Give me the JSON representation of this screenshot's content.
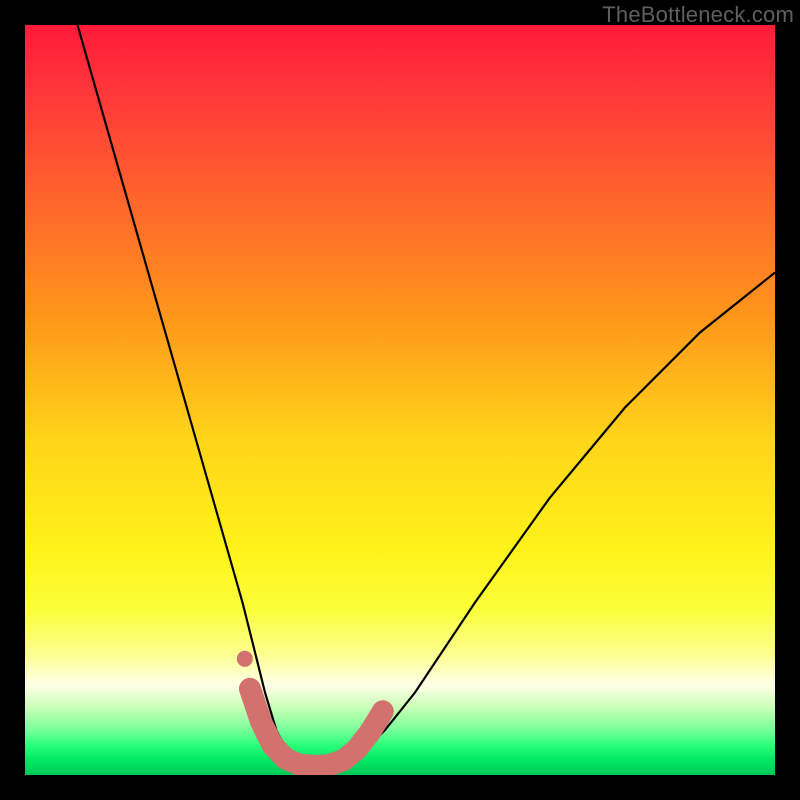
{
  "watermark": "TheBottleneck.com",
  "colors": {
    "curve_stroke": "#000000",
    "marker_fill": "#d2716e",
    "background_black": "#000000"
  },
  "chart_data": {
    "type": "line",
    "title": "",
    "xlabel": "",
    "ylabel": "",
    "xlim": [
      0,
      100
    ],
    "ylim": [
      0,
      100
    ],
    "grid": false,
    "legend": false,
    "series": [
      {
        "name": "bottleneck-curve",
        "x": [
          7,
          9,
          11,
          13,
          15,
          17,
          19,
          21,
          23,
          25,
          27,
          29,
          30.5,
          32,
          33.5,
          35,
          36.5,
          38,
          40,
          42,
          45,
          48,
          52,
          56,
          60,
          65,
          70,
          75,
          80,
          85,
          90,
          95,
          100
        ],
        "y": [
          100,
          93,
          86,
          79,
          72,
          65,
          58,
          51,
          44,
          37,
          30,
          23,
          17,
          11,
          6,
          3,
          1.5,
          1.2,
          1.2,
          1.5,
          3,
          6,
          11,
          17,
          23,
          30,
          37,
          43,
          49,
          54,
          59,
          63,
          67
        ]
      }
    ],
    "markers": [
      {
        "x_pct": 30.0,
        "y_pct_from_top": 88.5
      },
      {
        "x_pct": 31.5,
        "y_pct_from_top": 93.0
      },
      {
        "x_pct": 33.0,
        "y_pct_from_top": 96.0
      },
      {
        "x_pct": 34.7,
        "y_pct_from_top": 97.8
      },
      {
        "x_pct": 36.5,
        "y_pct_from_top": 98.6
      },
      {
        "x_pct": 38.5,
        "y_pct_from_top": 98.8
      },
      {
        "x_pct": 40.5,
        "y_pct_from_top": 98.7
      },
      {
        "x_pct": 42.5,
        "y_pct_from_top": 98.0
      },
      {
        "x_pct": 44.3,
        "y_pct_from_top": 96.5
      },
      {
        "x_pct": 46.0,
        "y_pct_from_top": 94.3
      },
      {
        "x_pct": 47.7,
        "y_pct_from_top": 91.5
      }
    ],
    "lone_marker": {
      "x_pct": 29.3,
      "y_pct_from_top": 84.5
    }
  }
}
